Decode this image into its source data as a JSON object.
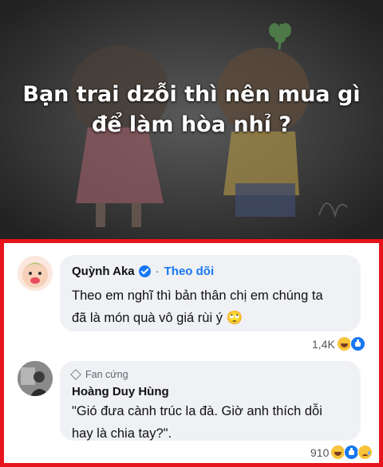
{
  "banner": {
    "title_line1": "Bạn trai dzỗi thì nên mua gì",
    "title_line2": "để làm hòa nhỉ ?"
  },
  "colors": {
    "frame": "#e8141c",
    "link": "#1877f2",
    "bubble": "#eff1f4"
  },
  "comments": [
    {
      "author": "Quỳnh Aka",
      "verified": true,
      "follow_label": "Theo dõi",
      "separator": "·",
      "text_line1": "Theo em nghĩ thì bản thân chị em chúng ta",
      "text_line2": "đã là món quà vô giá rùi ý 🙄",
      "reaction_count": "1,4K",
      "reactions": [
        "haha-icon",
        "like-icon"
      ]
    },
    {
      "badge": "Fan cứng",
      "author": "Hoàng Duy Hùng",
      "text_line1": "\"Gió đưa cành trúc la đà. Giờ anh thích dỗi",
      "text_line2": "hay là chia tay?\".",
      "reaction_count": "910",
      "reactions": [
        "haha-icon",
        "like-icon",
        "sad-icon"
      ]
    }
  ]
}
